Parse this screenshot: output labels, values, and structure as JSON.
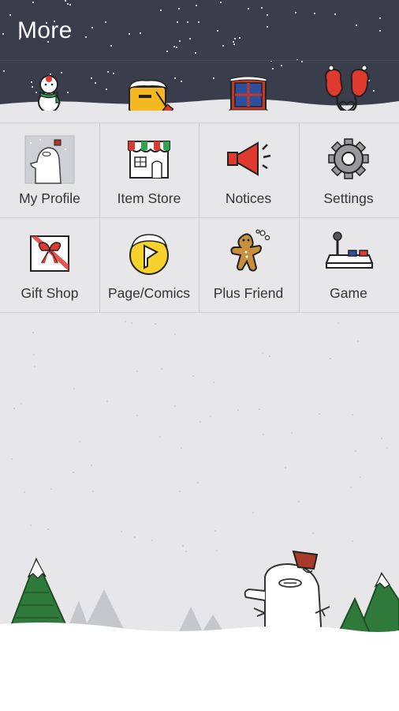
{
  "header": {
    "title": "More",
    "background_color": "#3a3d4b",
    "decorations": [
      "snowman-icon",
      "mailbox-icon",
      "window-icon",
      "mittens-icon"
    ]
  },
  "menu": {
    "items": [
      {
        "label": "My Profile",
        "icon": "profile-picture-icon"
      },
      {
        "label": "Item Store",
        "icon": "store-icon"
      },
      {
        "label": "Notices",
        "icon": "megaphone-icon"
      },
      {
        "label": "Settings",
        "icon": "gear-icon"
      },
      {
        "label": "Gift Shop",
        "icon": "gift-box-icon"
      },
      {
        "label": "Page/Comics",
        "icon": "page-comics-icon"
      },
      {
        "label": "Plus Friend",
        "icon": "gingerbread-icon"
      },
      {
        "label": "Game",
        "icon": "joystick-icon"
      }
    ]
  },
  "colors": {
    "page_background": "#e7e7e9",
    "label_text": "#333333",
    "accent_red": "#e03a2f"
  }
}
